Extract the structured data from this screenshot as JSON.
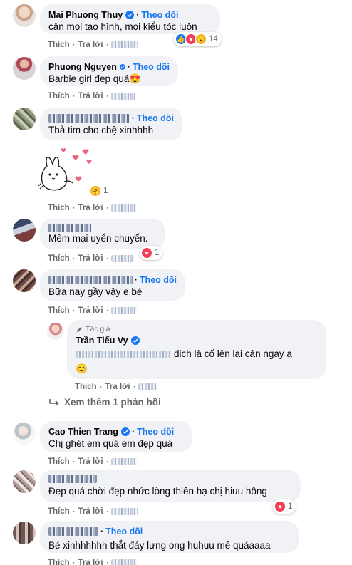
{
  "labels": {
    "like": "Thích",
    "reply": "Trả lời",
    "follow": "Theo dõi",
    "dot": "·",
    "author": "Tác giả",
    "view_more": "Xem thêm 1 phản hồi"
  },
  "comments": [
    {
      "name": "Mai Phuong Thuy",
      "text": "cân mọi tạo hình, mọi kiểu tóc luôn",
      "reactions": [
        "like",
        "love",
        "wow"
      ],
      "count": "14"
    },
    {
      "name": "Phuong Nguyen",
      "text": "Barbie girl đẹp quá",
      "emoji": "😍"
    },
    {
      "text": "Thả tim cho chệ xinhhhh"
    },
    {
      "sticker": "bunny-hearts-sticker",
      "reactions": [
        "care"
      ],
      "count": "1"
    },
    {
      "text": "Mềm mại uyển chuyển.",
      "reactions": [
        "love"
      ],
      "count": "1"
    },
    {
      "text": "Bữa nay gầy vậy e bé"
    },
    {
      "name": "Trần Tiểu Vy",
      "text": "dich là cố lên lại cân ngay ạ",
      "emoji": "😊"
    },
    {
      "name": "Cao Thien Trang",
      "text": "Chị ghét em quá em đẹp quá"
    },
    {
      "text": "Đẹp quá chời đẹp nhức lòng thiên hạ chị hiuu hông",
      "reactions": [
        "love"
      ],
      "count": "1"
    },
    {
      "text": "Bé xinhhhhhh thắt đáy lưng ong huhuu mê quáaaaa"
    }
  ],
  "colors": {
    "accent": "#1877f2",
    "bubble": "#f0f2f5",
    "muted": "#65676b",
    "love": "#f33e58"
  }
}
